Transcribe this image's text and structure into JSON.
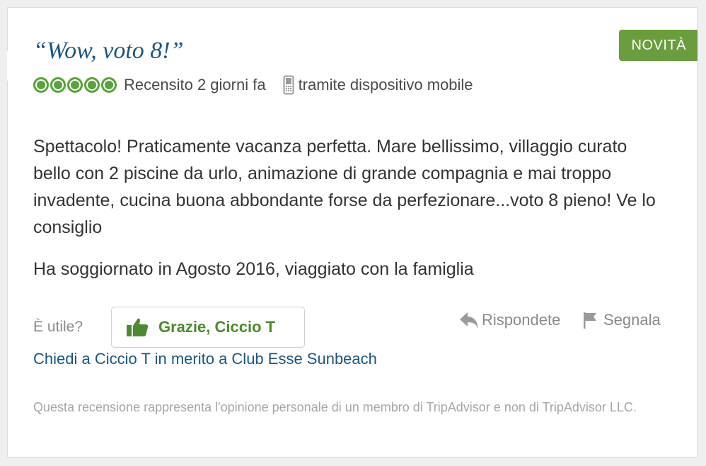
{
  "review": {
    "title": "“Wow, voto 8!”",
    "badge": "NOVITÀ",
    "rating_bubbles": 5,
    "rating_color": "#58a33b",
    "reviewed_text": "Recensito 2 giorni fa",
    "mobile_text": "tramite dispositivo mobile",
    "body": "Spettacolo! Praticamente vacanza perfetta. Mare bellissimo, villaggio curato bello con 2 piscine da urlo, animazione di grande compagnia e mai troppo invadente, cucina buona abbondante forse da perfezionare...voto 8 pieno! Ve lo consiglio",
    "stay": "Ha soggiornato in Agosto 2016, viaggiato con la famiglia"
  },
  "actions": {
    "helpful_label": "È utile?",
    "thanks_label": "Grazie, Ciccio T",
    "reply_label": "Rispondete",
    "flag_label": "Segnala",
    "ask_link": "Chiedi a Ciccio T in merito a Club Esse Sunbeach"
  },
  "footer": {
    "disclaimer": "Questa recensione rappresenta l'opinione personale di un membro di TripAdvisor e non di TripAdvisor LLC."
  },
  "icons": {
    "rating": "bubble-rating-icon",
    "mobile": "mobile-phone-icon",
    "thumb": "thumbs-up-icon",
    "reply": "reply-arrow-icon",
    "flag": "flag-icon"
  },
  "colors": {
    "title": "#1a5680",
    "badge_bg": "#6a9d3e",
    "thanks_text": "#4b8b2f",
    "muted": "#8a8a8a"
  }
}
